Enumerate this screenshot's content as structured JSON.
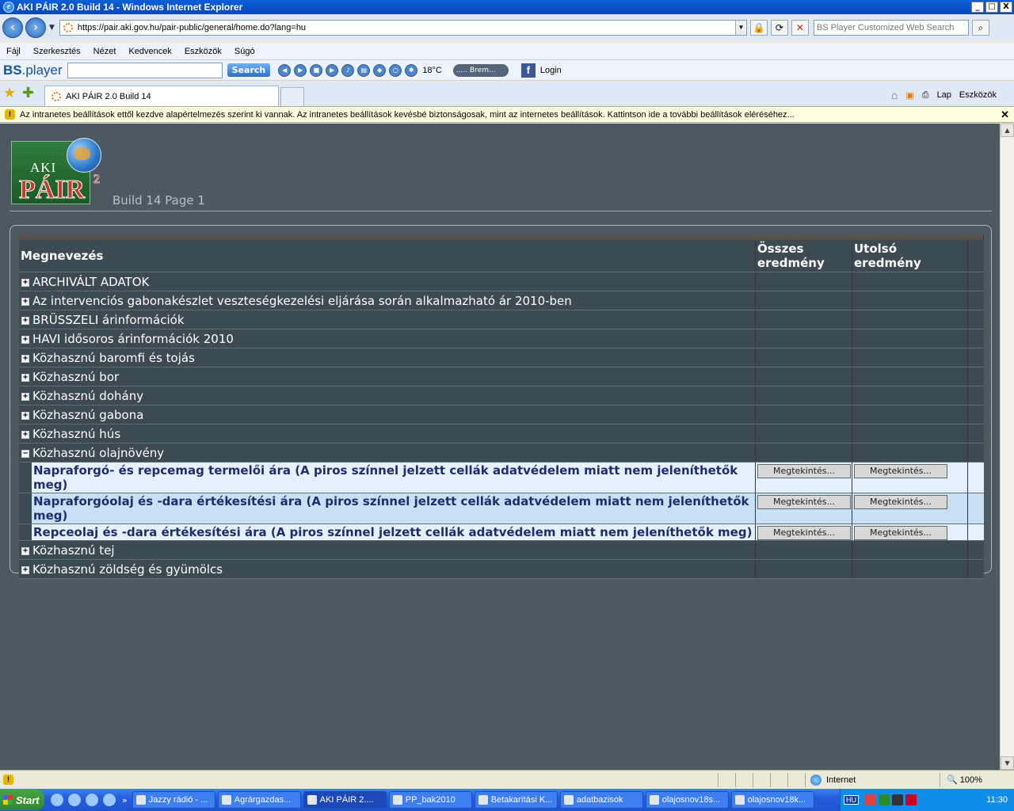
{
  "window": {
    "title": "AKI PÁIR 2.0 Build 14 - Windows Internet Explorer",
    "btn_min": "_",
    "btn_max": "□",
    "btn_close": "X"
  },
  "address": {
    "url": "https://pair.aki.gov.hu/pair-public/general/home.do?lang=hu",
    "search_placeholder": "BS Player Customized Web Search"
  },
  "menu": [
    "Fájl",
    "Szerkesztés",
    "Nézet",
    "Kedvencek",
    "Eszközök",
    "Súgó"
  ],
  "bsbar": {
    "logo_bold": "BS",
    "logo_rest": ".player",
    "search_label": "Search",
    "temperature": "18°C",
    "radio": "..... Brem...",
    "fb_letter": "f",
    "login": "Login"
  },
  "tabs": {
    "active_title": "AKI PÁIR 2.0 Build 14",
    "tools": [
      "Lap",
      "Eszközök"
    ]
  },
  "infobar": {
    "text": "Az intranetes beállítások ettől kezdve alapértelmezés szerint ki vannak. Az intranetes beállítások kevésbé biztonságosak, mint az internetes beállítások. Kattintson ide a további beállítások eléréséhez..."
  },
  "page": {
    "logo_aki": "AKI",
    "logo_pair": "PÁIR",
    "logo_sup": "2",
    "build": "Build 14 Page 1",
    "headers": {
      "name": "Megnevezés",
      "all_results": "Összes eredmény",
      "last_result": "Utolsó eredmény"
    },
    "view_label": "Megtekintés...",
    "categories_before": [
      {
        "name": "ARCHIVÁLT ADATOK",
        "toggle": "+"
      },
      {
        "name": "Az intervenciós gabonakészlet veszteségkezelési eljárása során alkalmazható ár 2010-ben",
        "toggle": "+"
      },
      {
        "name": "BRÜSSZELI árinformációk",
        "toggle": "+"
      },
      {
        "name": "HAVI idősoros árinformációk 2010",
        "toggle": "+"
      },
      {
        "name": "Közhasznú baromfi és tojás",
        "toggle": "+"
      },
      {
        "name": "Közhasznú bor",
        "toggle": "+"
      },
      {
        "name": "Közhasznú dohány",
        "toggle": "+"
      },
      {
        "name": "Közhasznú gabona",
        "toggle": "+"
      },
      {
        "name": "Közhasznú hús",
        "toggle": "+"
      },
      {
        "name": "Közhasznú olajnövény",
        "toggle": "−"
      }
    ],
    "items": [
      {
        "name": "Napraforgó- és repcemag termelői ára (A piros színnel jelzett cellák adatvédelem miatt nem jeleníthetők meg)"
      },
      {
        "name": "Napraforgóolaj és -dara értékesítési ára (A piros színnel jelzett cellák adatvédelem miatt nem jeleníthetők meg)"
      },
      {
        "name": "Repceolaj és -dara értékesítési ára (A piros színnel jelzett cellák adatvédelem miatt nem jeleníthetők meg)"
      }
    ],
    "categories_after": [
      {
        "name": "Közhasznú tej",
        "toggle": "+"
      },
      {
        "name": "Közhasznú zöldség és gyümölcs",
        "toggle": "+"
      }
    ]
  },
  "status": {
    "zone": "Internet",
    "zoom": "100%"
  },
  "taskbar": {
    "start": "Start",
    "tasks": [
      "Jazzy rádió - ...",
      "Agrárgazdas...",
      "AKI PÁIR 2....",
      "PP_bak2010",
      "Betakarítási K...",
      "adatbazisok",
      "olajosnov18s...",
      "olajosnov18k..."
    ],
    "lang": "HU",
    "clock": "11:30"
  }
}
